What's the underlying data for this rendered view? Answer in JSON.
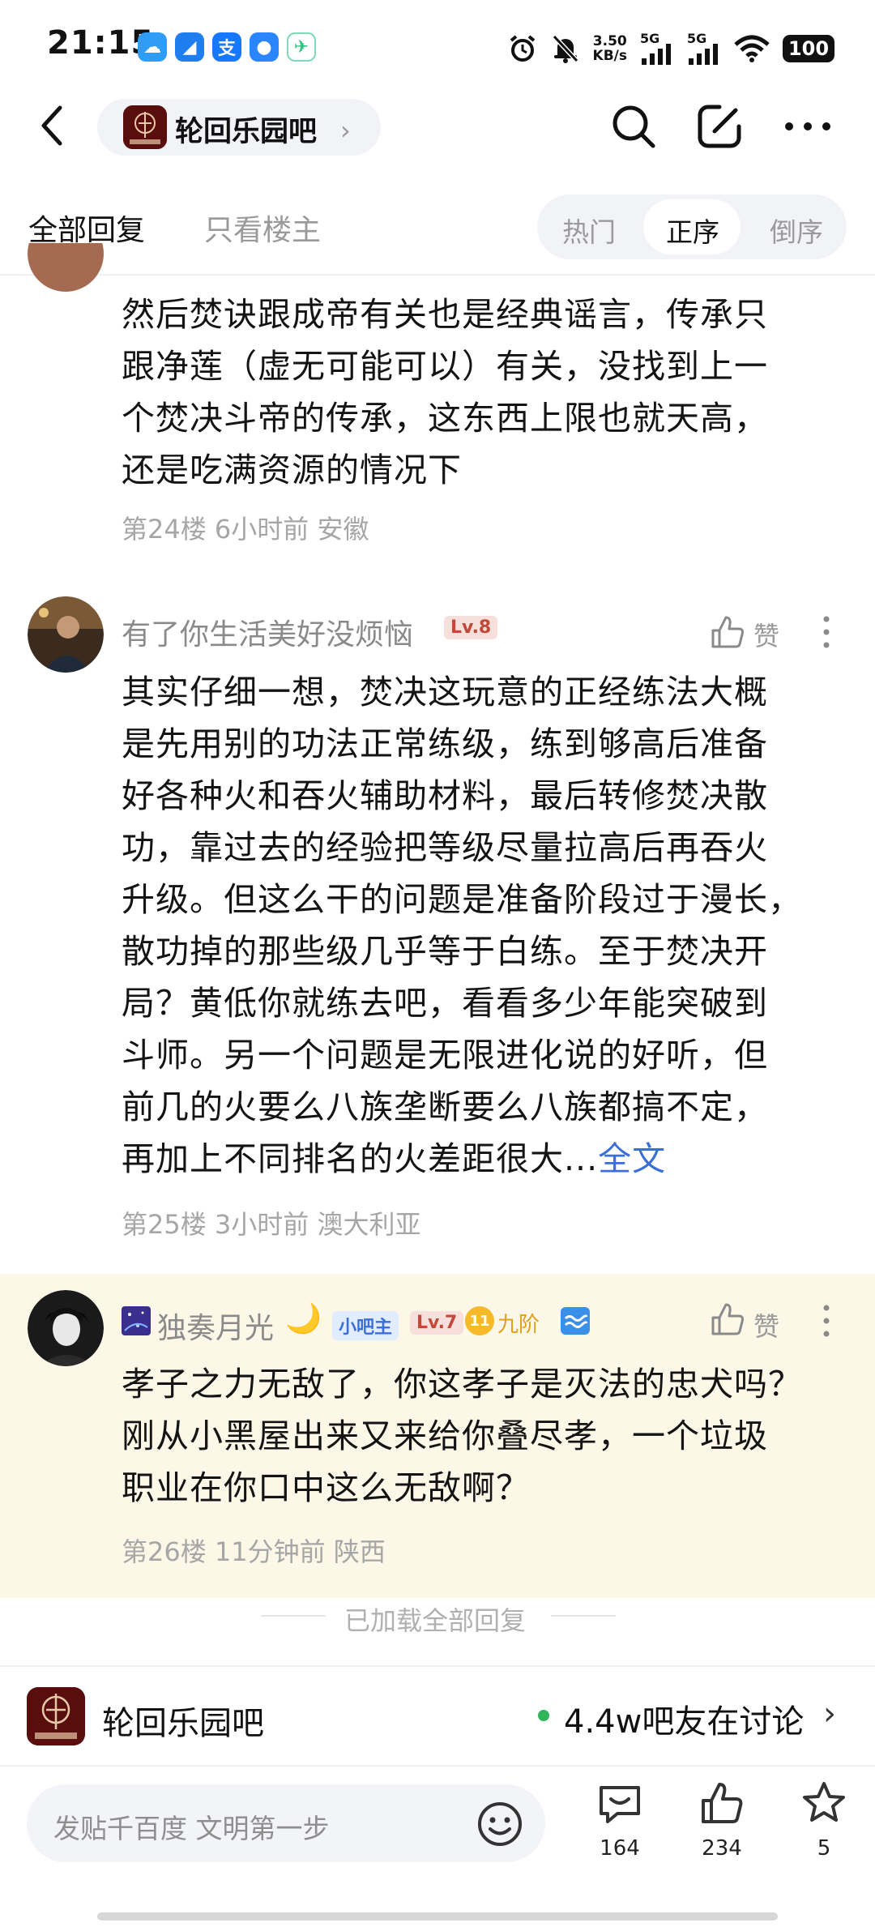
{
  "status_bar": {
    "time": "21:15",
    "net_speed_value": "3.50",
    "net_speed_unit": "KB/s",
    "signal_1": "5G",
    "signal_2": "5G",
    "battery": "100"
  },
  "header": {
    "forum_name": "轮回乐园吧",
    "chevron": "›"
  },
  "filter": {
    "tab_all": "全部回复",
    "tab_op": "只看楼主",
    "sort_hot": "热门",
    "sort_asc": "正序",
    "sort_desc": "倒序"
  },
  "posts": [
    {
      "lines": [
        "然后焚诀跟成帝有关也是经典谣言，传承只",
        "跟净莲（虚无可能可以）有关，没找到上一",
        "个焚决斗帝的传承，这东西上限也就天高，",
        "还是吃满资源的情况下"
      ],
      "floor": "第24楼",
      "time": "6小时前",
      "location": "安徽"
    },
    {
      "username": "有了你生活美好没烦恼",
      "level": "Lv.8",
      "like_label": "赞",
      "lines": [
        "其实仔细一想，焚决这玩意的正经练法大概",
        "是先用别的功法正常练级，练到够高后准备",
        "好各种火和吞火辅助材料，最后转修焚决散",
        "功，靠过去的经验把等级尽量拉高后再吞火",
        "升级。但这么干的问题是准备阶段过于漫长，",
        "散功掉的那些级几乎等于白练。至于焚决开",
        "局？黄低你就练去吧，看看多少年能突破到",
        "斗师。另一个问题是无限进化说的好听，但",
        "前几的火要么八族垄断要么八族都搞不定，"
      ],
      "last_line": "再加上不同排名的火差距很大...",
      "more_link": "全文",
      "floor": "第25楼",
      "time": "3小时前",
      "location": "澳大利亚"
    },
    {
      "username": "独奏月光",
      "role_badge": "小吧主",
      "level": "Lv.7",
      "rank_num": "11",
      "rank": "九阶",
      "like_label": "赞",
      "lines": [
        "孝子之力无敌了，你这孝子是灭法的忠犬吗？",
        "刚从小黑屋出来又来给你叠尽孝，一个垃圾",
        "职业在你口中这么无敌啊？"
      ],
      "floor": "第26楼",
      "time": "11分钟前",
      "location": "陕西"
    }
  ],
  "loaded_all": "已加载全部回复",
  "bottom": {
    "forum_name": "轮回乐园吧",
    "online_text": "4.4w吧友在讨论",
    "input_placeholder": "发贴千百度 文明第一步",
    "comments_count": "164",
    "likes_count": "234",
    "favorites_count": "5"
  },
  "colors": {
    "highlight_bg": "#fcf7e7",
    "link_blue": "#3a6fd8",
    "level_badge": "#f3dddd",
    "online_green": "#2fb55a"
  }
}
